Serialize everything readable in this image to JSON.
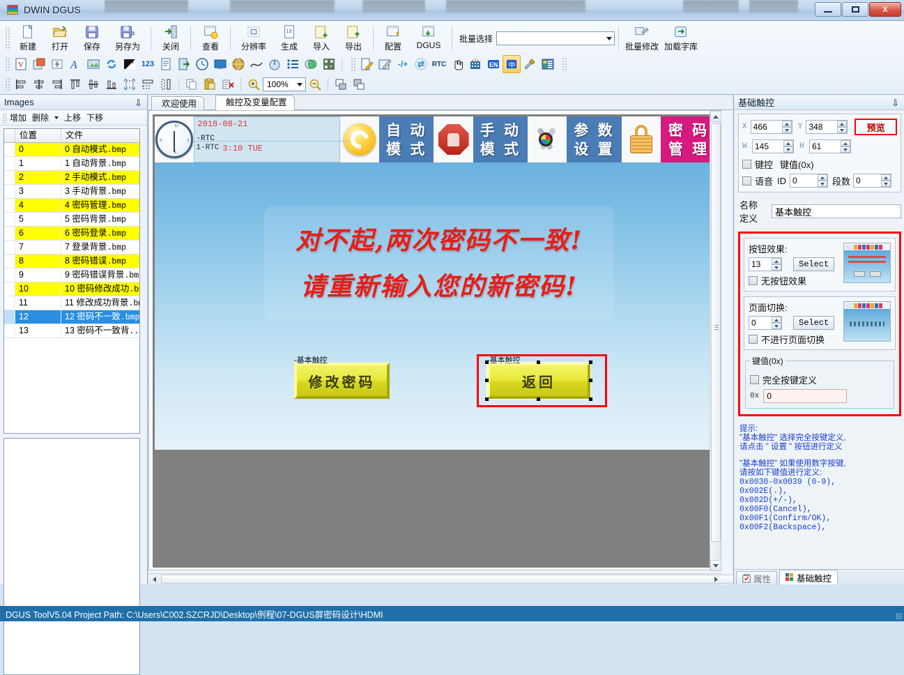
{
  "window": {
    "title": "DWIN DGUS",
    "minimize_label": "–",
    "maximize_label": "□",
    "close_label": "X"
  },
  "toolbar_main": {
    "buttons": [
      {
        "label": "新建",
        "icon": "new-file-icon"
      },
      {
        "label": "打开",
        "icon": "open-folder-icon"
      },
      {
        "label": "保存",
        "icon": "save-disk-icon"
      },
      {
        "label": "另存为",
        "icon": "save-as-icon"
      },
      {
        "label": "关闭",
        "icon": "close-door-icon"
      },
      {
        "label": "查看",
        "icon": "view-icon"
      },
      {
        "label": "分辨率",
        "icon": "resolution-icon"
      },
      {
        "label": "生成",
        "icon": "generate-icon"
      },
      {
        "label": "导入",
        "icon": "import-icon"
      },
      {
        "label": "导出",
        "icon": "export-icon"
      },
      {
        "label": "配置",
        "icon": "config-icon"
      },
      {
        "label": "DGUS",
        "icon": "dgus-icon"
      }
    ],
    "batch_select_label": "批量选择",
    "batch_select_value": "",
    "batch_modify_label": "批量修改",
    "load_font_label": "加载字库"
  },
  "toolbar_widgets": {
    "icons": [
      "variable-icon",
      "picture-overlay-icon",
      "insert-field-icon",
      "text-icon",
      "image-icon",
      "refresh-icon",
      "slider-icon",
      "number-123-icon",
      "text-doc-icon",
      "jump-page-icon",
      "clock-icon",
      "monitor-icon",
      "globe-icon",
      "curve-icon",
      "circle-gauge-icon",
      "list-icon",
      "venn-icon",
      "qrcode-icon",
      "edit-doc-icon",
      "edit-pen-icon",
      "plus-minus-icon",
      "swap-icon",
      "rtc-icon",
      "hand-cursor-icon",
      "matrix-icon",
      "en-lang-icon",
      "cn-lang-icon",
      "tools-icon",
      "layout-icon"
    ],
    "rtc_label": "RTC",
    "en_label": "EN",
    "cn_label": "中"
  },
  "toolbar_align": {
    "icons": [
      "align-left-icon",
      "align-center-h-icon",
      "align-right-icon",
      "align-top-icon",
      "align-middle-icon",
      "align-bottom-icon",
      "same-size-icon",
      "same-width-icon",
      "same-height-icon",
      "copy-icon",
      "paste-icon",
      "delete-icon",
      "zoom-in-icon",
      "zoom-out-icon",
      "bring-front-icon",
      "send-back-icon"
    ],
    "zoom_value": "100%"
  },
  "images_panel": {
    "title": "Images",
    "pin_icon": "pin-icon",
    "actions": [
      "增加",
      "删除",
      "上移",
      "下移"
    ],
    "columns": [
      "位置",
      "文件"
    ],
    "rows": [
      {
        "pos": "0",
        "name": "0 自动模式",
        "ext": ".bmp",
        "state": "highlight"
      },
      {
        "pos": "1",
        "name": "1 自动背景",
        "ext": ".bmp",
        "state": "normal"
      },
      {
        "pos": "2",
        "name": "2 手动模式",
        "ext": ".bmp",
        "state": "highlight"
      },
      {
        "pos": "3",
        "name": "3 手动背景",
        "ext": ".bmp",
        "state": "normal"
      },
      {
        "pos": "4",
        "name": "4 密码管理",
        "ext": ".bmp",
        "state": "highlight"
      },
      {
        "pos": "5",
        "name": "5 密码背景",
        "ext": ".bmp",
        "state": "normal"
      },
      {
        "pos": "6",
        "name": "6 密码登录",
        "ext": ".bmp",
        "state": "highlight"
      },
      {
        "pos": "7",
        "name": "7 登录背景",
        "ext": ".bmp",
        "state": "normal"
      },
      {
        "pos": "8",
        "name": "8 密码错误",
        "ext": ".bmp",
        "state": "highlight"
      },
      {
        "pos": "9",
        "name": "9 密码错误背景",
        "ext": ".bmp",
        "state": "normal"
      },
      {
        "pos": "10",
        "name": "10 密码修改成功",
        "ext": ".bmp",
        "state": "highlight"
      },
      {
        "pos": "11",
        "name": "11 修改成功背景",
        "ext": ".bmp",
        "state": "normal"
      },
      {
        "pos": "12",
        "name": "12 密码不一致",
        "ext": ".bmp",
        "state": "selected"
      },
      {
        "pos": "13",
        "name": "13 密码不一致背",
        "ext": "...",
        "state": "normal"
      }
    ]
  },
  "editor": {
    "tabs": [
      {
        "label": "欢迎使用",
        "active": false
      },
      {
        "label": "触控及变量配置",
        "active": true
      }
    ],
    "screen": {
      "rtc": {
        "date": "2018-08-21",
        "tag": "-RTC",
        "tag2": "1-RTC",
        "time": "3:10 TUE"
      },
      "nav": [
        {
          "label_line1": "自 动",
          "label_line2": "模 式",
          "icon": "recycle-arrows-icon",
          "color": "#4a7cb5"
        },
        {
          "label_line1": "手 动",
          "label_line2": "模 式",
          "icon": "stop-hand-icon",
          "color": "#4a7cb5"
        },
        {
          "label_line1": "参 数",
          "label_line2": "设 置",
          "icon": "tools-color-icon",
          "color": "#4a7cb5"
        },
        {
          "label_line1": "密 码",
          "label_line2": "管 理",
          "icon": "lock-icon",
          "color": "#d8197f"
        }
      ],
      "banner_line1": "对不起,两次密码不一致!",
      "banner_line2": "请重新输入您的新密码!",
      "controls": [
        {
          "tag": "-基本触控",
          "label": "修改密码",
          "selected": false
        },
        {
          "tag": "-基本触控",
          "label": "返回",
          "selected": true
        }
      ]
    }
  },
  "properties_panel": {
    "title": "基础触控",
    "pin_icon": "pin-icon",
    "coords": {
      "x_label": "X",
      "x_value": "466",
      "y_label": "Y",
      "y_value": "348",
      "w_label": "W",
      "w_value": "145",
      "h_label": "H",
      "h_value": "61"
    },
    "preview_button": "预览",
    "keycontrol_label": "键控",
    "keyvalue_label": "键值(0x)",
    "voice_label": "语音",
    "voice_id_label": "ID",
    "voice_id_value": "0",
    "segment_label": "段数",
    "segment_value": "0",
    "name_label": "名称定义",
    "name_value": "基本触控",
    "button_effect": {
      "title": "按钮效果:",
      "value": "13",
      "select_label": "Select",
      "no_effect_label": "无按钮效果"
    },
    "page_switch": {
      "title": "页面切换:",
      "value": "0",
      "select_label": "Select",
      "no_switch_label": "不进行页面切换"
    },
    "key_value": {
      "title": "键值(0x)",
      "full_key_label": "完全按键定义",
      "prefix": "0x",
      "value": "0"
    },
    "tips": {
      "line1": "提示:",
      "line2": "\"基本触控\" 选择完全按键定义,",
      "line3": "请点击 \" 设置 \" 按钮进行定义",
      "line4": "\"基本触控\" 如果使用数字按键,",
      "line5": "请按如下键值进行定义:",
      "codes": [
        "0x0030-0x0039 (0-9),",
        "0x002E(.),",
        "0x002D(+/-),",
        "0x00F0(Cancel),",
        "0x00F1(Confirm/OK),",
        "0x00F2(Backspace),"
      ]
    },
    "tabs": [
      {
        "label": "属性",
        "icon": "clipboard-icon",
        "active": false
      },
      {
        "label": "基础触控",
        "icon": "blocks-icon",
        "active": true
      }
    ]
  },
  "statusbar": {
    "text": "DGUS ToolV5.04  Project Path: C:\\Users\\C002.SZCRJD\\Desktop\\例程\\07-DGUS屏密码设计\\HDMI"
  }
}
